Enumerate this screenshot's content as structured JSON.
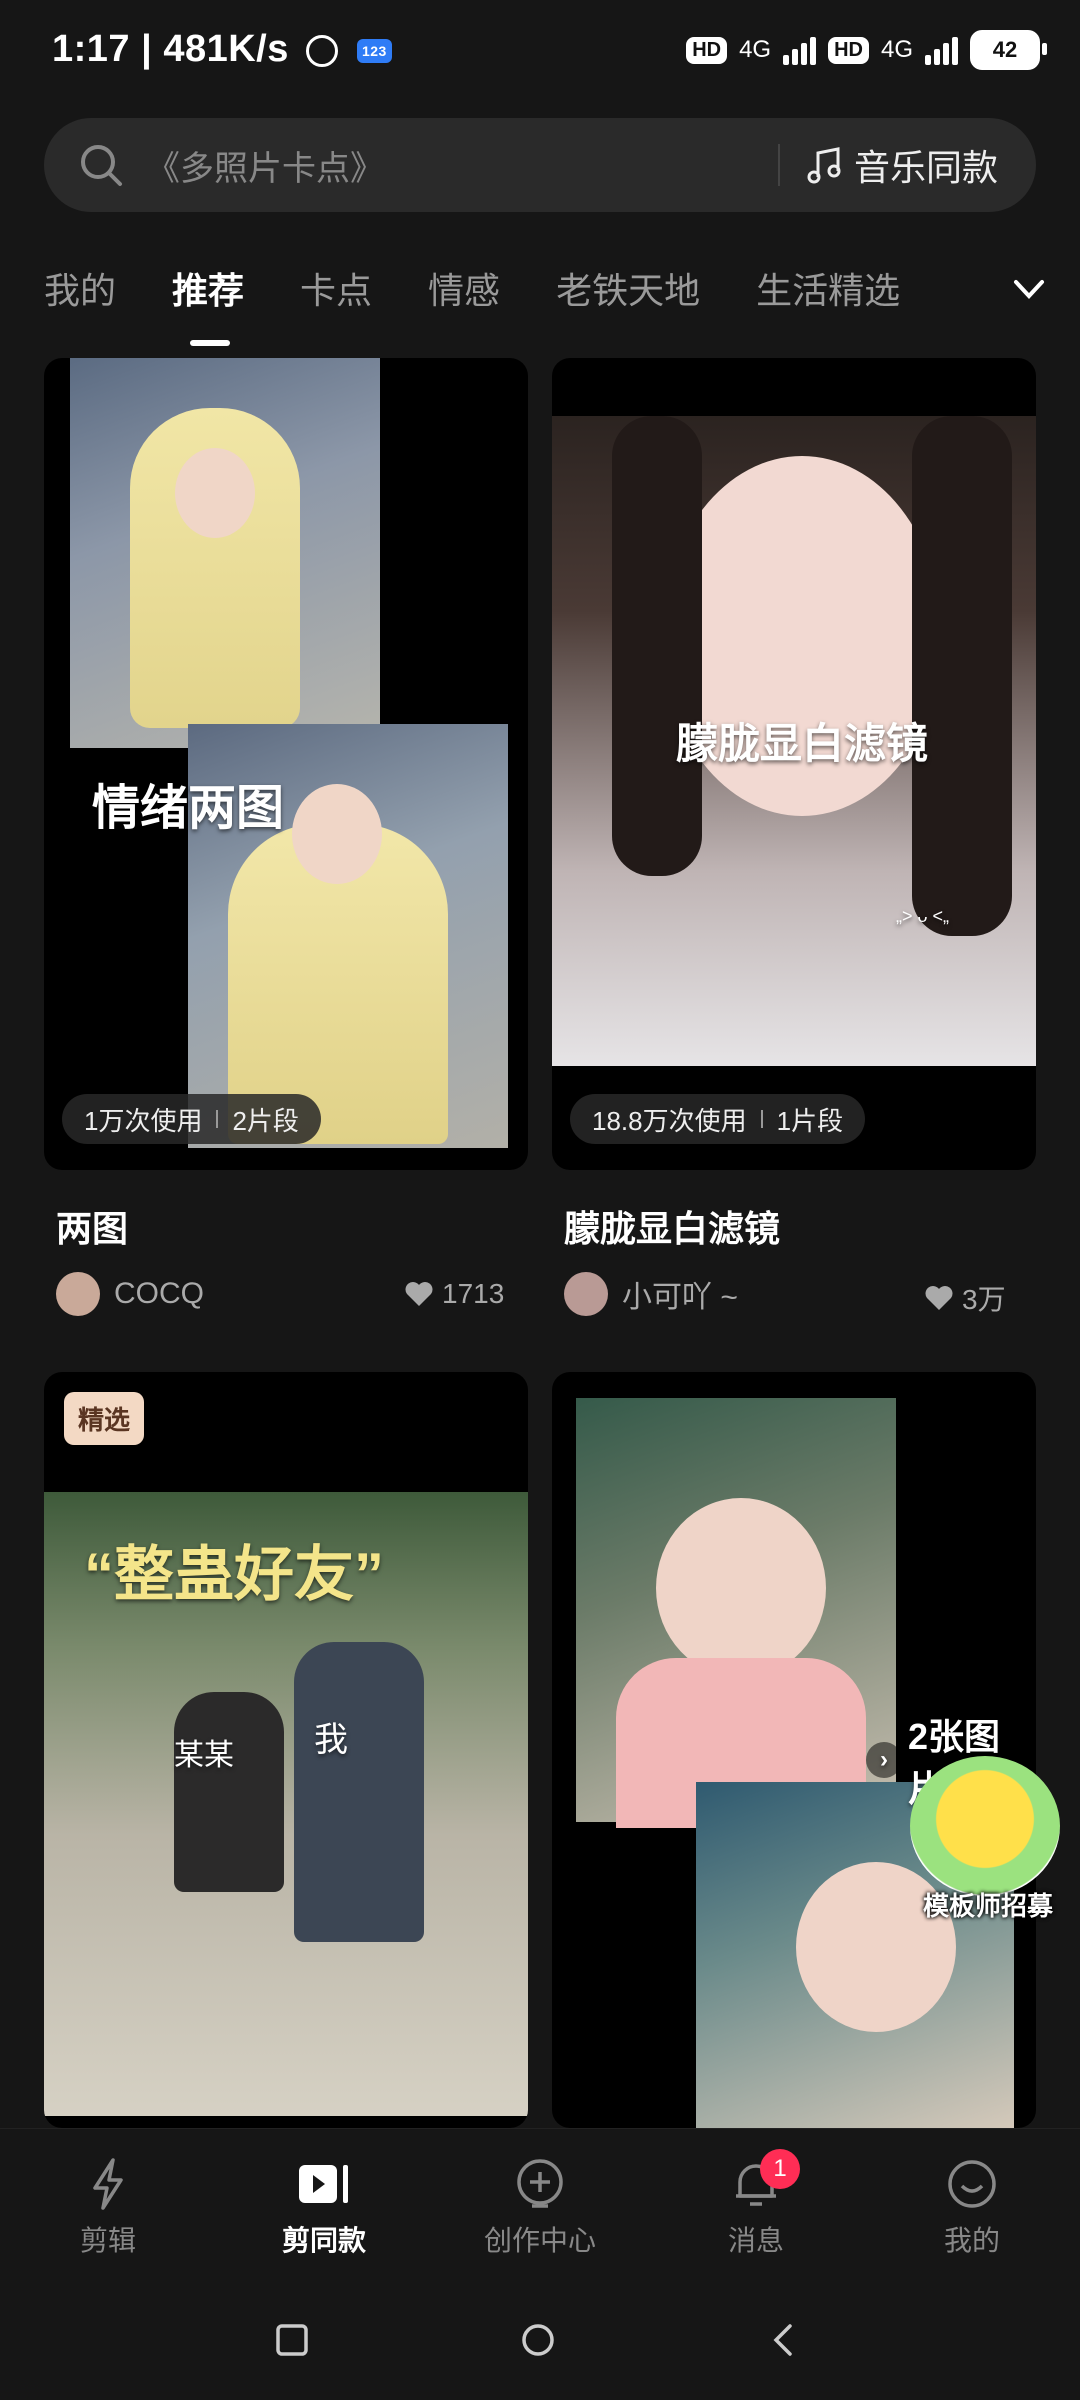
{
  "status_bar": {
    "time": "1:17",
    "speed": "481K/s",
    "app_badge": "123",
    "hd1": "HD",
    "net1": "4G",
    "hd2": "HD",
    "net2": "4G",
    "battery": "42"
  },
  "search": {
    "placeholder": "《多照片卡点》",
    "music_label": "音乐同款"
  },
  "tabs": [
    "我的",
    "推荐",
    "卡点",
    "情感",
    "老铁天地",
    "生活精选"
  ],
  "cards": [
    {
      "title": "两图",
      "overlay": "情绪两图",
      "uses": "1万次使用",
      "segments": "2片段",
      "author": "COCQ",
      "likes": "1713"
    },
    {
      "title": "朦胧显白滤镜",
      "overlay": "朦胧显白滤镜",
      "uses": "18.8万次使用",
      "segments": "1片段",
      "author": "小可吖 ~",
      "likes": "3万",
      "small_text": "„> ᴗ <„"
    },
    {
      "badge": "精选",
      "overlay": "“整蛊好友”",
      "label1": "某某",
      "label2": "我"
    },
    {
      "overlay": "2张图片",
      "promo": "模板师招募"
    }
  ],
  "bottom_nav": [
    {
      "label": "剪辑",
      "icon": "lightning-icon"
    },
    {
      "label": "剪同款",
      "icon": "play-clip-icon"
    },
    {
      "label": "创作中心",
      "icon": "create-icon"
    },
    {
      "label": "消息",
      "icon": "bell-icon",
      "badge": "1"
    },
    {
      "label": "我的",
      "icon": "smile-icon"
    }
  ]
}
